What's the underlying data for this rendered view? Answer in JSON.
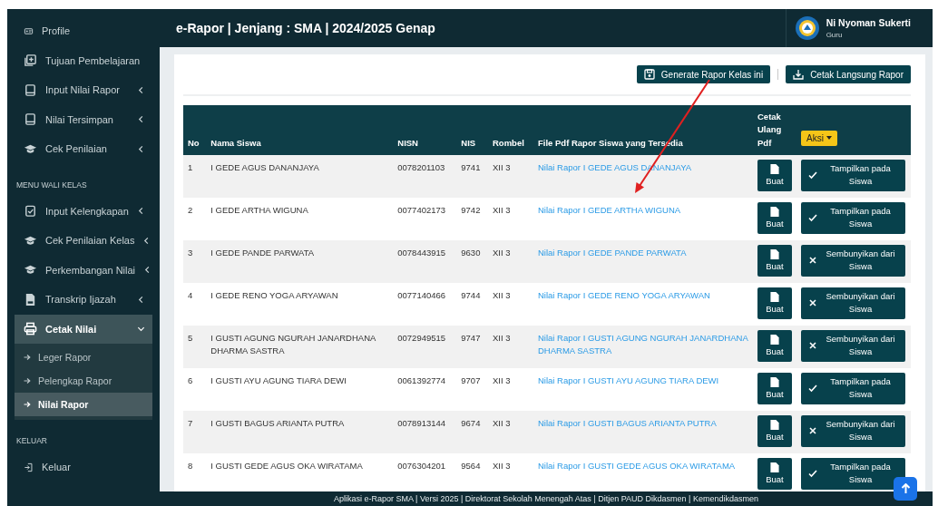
{
  "sidebar": {
    "sections": [
      {
        "items": [
          {
            "label": "Profile",
            "kind": "link"
          },
          {
            "label": "Tujuan Pembelajaran",
            "kind": "link"
          },
          {
            "label": "Input Nilai Rapor",
            "kind": "menu",
            "expanded": false
          },
          {
            "label": "Nilai Tersimpan",
            "kind": "menu",
            "expanded": false
          },
          {
            "label": "Cek Penilaian",
            "kind": "menu",
            "expanded": false
          }
        ]
      },
      {
        "title": "MENU WALI KELAS",
        "items": [
          {
            "label": "Input Kelengkapan",
            "kind": "menu",
            "expanded": false
          },
          {
            "label": "Cek Penilaian Kelas",
            "kind": "menu",
            "expanded": false
          },
          {
            "label": "Perkembangan Nilai",
            "kind": "menu",
            "expanded": false
          },
          {
            "label": "Transkrip Ijazah",
            "kind": "menu",
            "expanded": false
          },
          {
            "label": "Cetak Nilai",
            "kind": "menu",
            "expanded": true,
            "children": [
              {
                "label": "Leger Rapor",
                "selected": false
              },
              {
                "label": "Pelengkap Rapor",
                "selected": false
              },
              {
                "label": "Nilai Rapor",
                "selected": true
              }
            ]
          }
        ]
      },
      {
        "title": "KELUAR",
        "items": [
          {
            "label": "Keluar",
            "kind": "link"
          }
        ]
      }
    ]
  },
  "header": {
    "title": "e-Rapor | Jenjang : SMA | 2024/2025 Genap",
    "user": {
      "name": "Ni Nyoman Sukerti",
      "role": "Guru"
    }
  },
  "toolbar": {
    "buttons": [
      "Generate Rapor Kelas ini",
      "Cetak Langsung Rapor"
    ]
  },
  "table": {
    "columns": [
      "No",
      "Nama Siswa",
      "NISN",
      "NIS",
      "Rombel",
      "File Pdf Rapor Siswa yang Tersedia",
      "Cetak Ulang Pdf"
    ],
    "action_menu": "Aksi",
    "rows": [
      {
        "no": "1",
        "name": "I GEDE AGUS DANANJAYA",
        "nisn": "0078201103",
        "nis": "9741",
        "rombel": "XII 3",
        "file": "Nilai Rapor I GEDE AGUS DANANJAYA",
        "print": "Buat",
        "action": {
          "kind": "show",
          "label": "Tampilkan pada Siswa"
        }
      },
      {
        "no": "2",
        "name": "I GEDE ARTHA WIGUNA",
        "nisn": "0077402173",
        "nis": "9742",
        "rombel": "XII 3",
        "file": "Nilai Rapor I GEDE ARTHA WIGUNA",
        "print": "Buat",
        "action": {
          "kind": "show",
          "label": "Tampilkan pada Siswa"
        }
      },
      {
        "no": "3",
        "name": "I GEDE PANDE PARWATA",
        "nisn": "0078443915",
        "nis": "9630",
        "rombel": "XII 3",
        "file": "Nilai Rapor I GEDE PANDE PARWATA",
        "print": "Buat",
        "action": {
          "kind": "hide",
          "label": "Sembunyikan dari Siswa"
        }
      },
      {
        "no": "4",
        "name": "I GEDE RENO YOGA ARYAWAN",
        "nisn": "0077140466",
        "nis": "9744",
        "rombel": "XII 3",
        "file": "Nilai Rapor I GEDE RENO YOGA ARYAWAN",
        "print": "Buat",
        "action": {
          "kind": "hide",
          "label": "Sembunyikan dari Siswa"
        }
      },
      {
        "no": "5",
        "name": "I GUSTI AGUNG NGURAH JANARDHANA DHARMA SASTRA",
        "nisn": "0072949515",
        "nis": "9747",
        "rombel": "XII 3",
        "file": "Nilai Rapor I GUSTI AGUNG NGURAH JANARDHANA DHARMA SASTRA",
        "print": "Buat",
        "action": {
          "kind": "hide",
          "label": "Sembunyikan dari Siswa"
        }
      },
      {
        "no": "6",
        "name": "I GUSTI AYU AGUNG TIARA DEWI",
        "nisn": "0061392774",
        "nis": "9707",
        "rombel": "XII 3",
        "file": "Nilai Rapor I GUSTI AYU AGUNG TIARA DEWI",
        "print": "Buat",
        "action": {
          "kind": "show",
          "label": "Tampilkan pada Siswa"
        }
      },
      {
        "no": "7",
        "name": "I GUSTI BAGUS ARIANTA PUTRA",
        "nisn": "0078913144",
        "nis": "9674",
        "rombel": "XII 3",
        "file": "Nilai Rapor I GUSTI BAGUS ARIANTA PUTRA",
        "print": "Buat",
        "action": {
          "kind": "hide",
          "label": "Sembunyikan dari Siswa"
        }
      },
      {
        "no": "8",
        "name": "I GUSTI GEDE AGUS OKA WIRATAMA",
        "nisn": "0076304201",
        "nis": "9564",
        "rombel": "XII 3",
        "file": "Nilai Rapor I GUSTI GEDE AGUS OKA WIRATAMA",
        "print": "Buat",
        "action": {
          "kind": "show",
          "label": "Tampilkan pada Siswa"
        }
      }
    ]
  },
  "footer": "Aplikasi e-Rapor SMA | Versi 2025 | Direktorat Sekolah Menengah Atas | Ditjen PAUD Dikdasmen | Kemendikdasmen"
}
